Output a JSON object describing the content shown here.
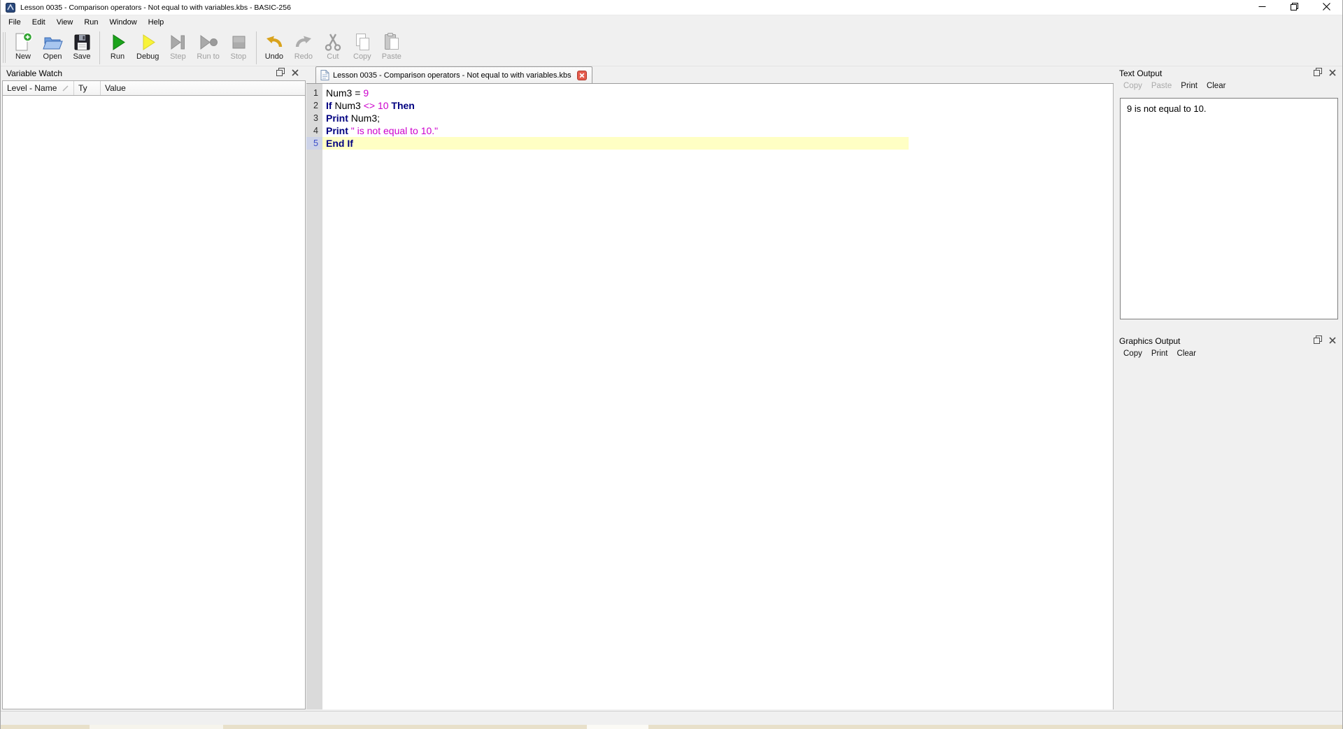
{
  "window": {
    "title": "Lesson 0035 - Comparison operators - Not equal to with variables.kbs - BASIC-256",
    "app_icon": "basic256-app-icon",
    "controls": [
      {
        "name": "minimize",
        "icon": "minimize-icon"
      },
      {
        "name": "restore",
        "icon": "restore-icon"
      },
      {
        "name": "close",
        "icon": "close-window-icon"
      }
    ]
  },
  "menu_items": [
    "File",
    "Edit",
    "View",
    "Run",
    "Window",
    "Help"
  ],
  "toolbar_buttons": [
    {
      "label": "New",
      "icon": "new-document-icon",
      "enabled": true
    },
    {
      "label": "Open",
      "icon": "open-folder-icon",
      "enabled": true
    },
    {
      "label": "Save",
      "icon": "save-floppy-icon",
      "enabled": true
    },
    {
      "label": "Run",
      "icon": "run-icon",
      "enabled": true
    },
    {
      "label": "Debug",
      "icon": "debug-icon",
      "enabled": true
    },
    {
      "label": "Step",
      "icon": "step-icon",
      "enabled": false
    },
    {
      "label": "Run to",
      "icon": "run-to-icon",
      "enabled": false
    },
    {
      "label": "Stop",
      "icon": "stop-icon",
      "enabled": false
    },
    {
      "label": "Undo",
      "icon": "undo-icon",
      "enabled": true
    },
    {
      "label": "Redo",
      "icon": "redo-icon",
      "enabled": false
    },
    {
      "label": "Cut",
      "icon": "cut-icon",
      "enabled": false
    },
    {
      "label": "Copy",
      "icon": "copy-icon",
      "enabled": false
    },
    {
      "label": "Paste",
      "icon": "paste-icon",
      "enabled": false
    }
  ],
  "variable_watch": {
    "title": "Variable Watch",
    "columns": [
      "Level - Name",
      "Ty",
      "Value"
    ],
    "sort_indicator_column": 0,
    "header_icons": [
      "float-icon",
      "close-icon"
    ],
    "rows": []
  },
  "editor": {
    "tab_label": "Lesson 0035 - Comparison operators - Not equal to with variables.kbs",
    "tab_icon": "document-icon",
    "tab_close_icon": "tab-close-icon",
    "code_lines": [
      {
        "number": "1",
        "current": false,
        "segments": [
          [
            "plain",
            "Num3 = "
          ],
          [
            "literal",
            "9"
          ]
        ]
      },
      {
        "number": "2",
        "current": false,
        "segments": [
          [
            "keyword",
            "If"
          ],
          [
            "plain",
            " Num3 "
          ],
          [
            "literal",
            "<>"
          ],
          [
            "plain",
            " "
          ],
          [
            "literal",
            "10"
          ],
          [
            "plain",
            " "
          ],
          [
            "keyword",
            "Then"
          ]
        ]
      },
      {
        "number": "3",
        "current": false,
        "segments": [
          [
            "keyword",
            "Print"
          ],
          [
            "plain",
            " Num3;"
          ]
        ]
      },
      {
        "number": "4",
        "current": false,
        "segments": [
          [
            "keyword",
            "Print"
          ],
          [
            "plain",
            " "
          ],
          [
            "literal",
            "\" is not equal to 10.\""
          ]
        ]
      },
      {
        "number": "5",
        "current": true,
        "segments": [
          [
            "keyword",
            "End If"
          ]
        ]
      }
    ]
  },
  "text_output": {
    "title": "Text Output",
    "header_icons": [
      "float-icon",
      "close-icon"
    ],
    "buttons": [
      {
        "label": "Copy",
        "enabled": false
      },
      {
        "label": "Paste",
        "enabled": false
      },
      {
        "label": "Print",
        "enabled": true
      },
      {
        "label": "Clear",
        "enabled": true
      }
    ],
    "content": "9 is not equal to 10."
  },
  "graphics_output": {
    "title": "Graphics Output",
    "header_icons": [
      "float-icon",
      "close-icon"
    ],
    "buttons": [
      {
        "label": "Copy",
        "enabled": true
      },
      {
        "label": "Print",
        "enabled": true
      },
      {
        "label": "Clear",
        "enabled": true
      }
    ]
  },
  "colors": {
    "keyword": "#000080",
    "literal": "#cc00cc",
    "current_line_bg": "#ffffc4",
    "current_line_number": "#3c4ec8",
    "run_green": "#1ca31c",
    "debug_yellow": "#f8f339",
    "undo_gold": "#d9a31d",
    "tab_close_red": "#e45b4c",
    "panel_bg": "#f0f0f0",
    "gutter_bg": "#dadada"
  }
}
